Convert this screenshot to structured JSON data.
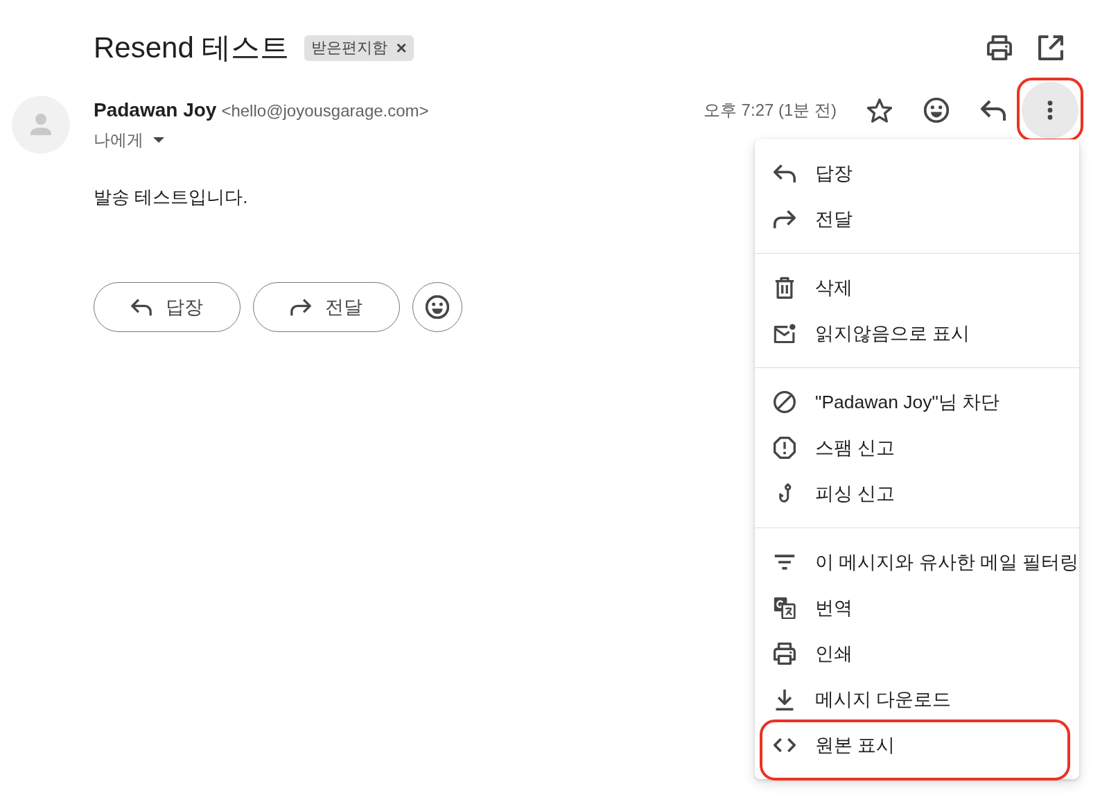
{
  "header": {
    "title": "Resend 테스트",
    "labels": [
      {
        "text": "받은편지함",
        "remove": "×"
      }
    ]
  },
  "message": {
    "sender_name": "Padawan Joy",
    "sender_email": "<hello@joyousgarage.com>",
    "recipient": "나에게",
    "time": "오후 7:27 (1분 전)",
    "starred": false,
    "more_button": {
      "active": true,
      "highlighted": true
    },
    "body": "발송 테스트입니다.",
    "actions": [
      {
        "label": "답장"
      },
      {
        "label": "전달"
      }
    ]
  },
  "menu": {
    "sections": [
      {
        "items": [
          {
            "label": "답장",
            "highlighted": false
          },
          {
            "label": "전달",
            "highlighted": false
          }
        ]
      },
      {
        "items": [
          {
            "label": "삭제",
            "highlighted": false
          },
          {
            "label": "읽지않음으로 표시",
            "highlighted": false
          }
        ]
      },
      {
        "items": [
          {
            "label": "\"Padawan Joy\"님 차단",
            "highlighted": false
          },
          {
            "label": "스팸 신고",
            "highlighted": false
          },
          {
            "label": "피싱 신고",
            "highlighted": false
          }
        ]
      },
      {
        "items": [
          {
            "label": "이 메시지와 유사한 메일 필터링",
            "highlighted": false
          },
          {
            "label": "번역",
            "highlighted": false
          },
          {
            "label": "인쇄",
            "highlighted": false
          },
          {
            "label": "메시지 다운로드",
            "highlighted": false
          },
          {
            "label": "원본 표시",
            "highlighted": true
          }
        ]
      }
    ]
  }
}
